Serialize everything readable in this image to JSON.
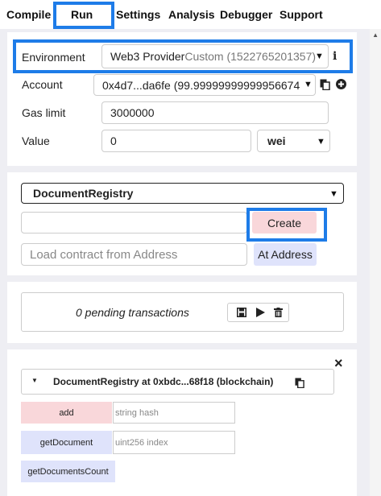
{
  "tabs": [
    "Compile",
    "Run",
    "Settings",
    "Analysis",
    "Debugger",
    "Support"
  ],
  "env": {
    "environment_label": "Environment",
    "environment_value": "Web3 Provider",
    "environment_custom": "Custom (1522765201357)",
    "info_glyph": "i",
    "account_label": "Account",
    "account_value": "0x4d7...da6fe (99.99999999999956674",
    "gas_label": "Gas limit",
    "gas_value": "3000000",
    "value_label": "Value",
    "value_value": "0",
    "unit_value": "wei"
  },
  "deploy": {
    "contract_select": "DocumentRegistry",
    "create_label": "Create",
    "at_address_placeholder": "Load contract from Address",
    "at_address_label": "At Address"
  },
  "pending": {
    "text": "0 pending transactions"
  },
  "instance": {
    "title": "DocumentRegistry at 0xbdc...68f18 (blockchain)",
    "functions": [
      {
        "name": "add",
        "placeholder": "string hash"
      },
      {
        "name": "getDocument",
        "placeholder": "uint256 index"
      },
      {
        "name": "getDocumentsCount"
      }
    ]
  },
  "colors": {
    "highlight": "#1e7ce8",
    "transact_button": "#f9d7da",
    "call_button": "#dfe3fb"
  },
  "icons": [
    "copy-icon",
    "plus-circle-icon",
    "save-icon",
    "play-icon",
    "trash-icon",
    "close-icon",
    "chevron-down-icon"
  ]
}
